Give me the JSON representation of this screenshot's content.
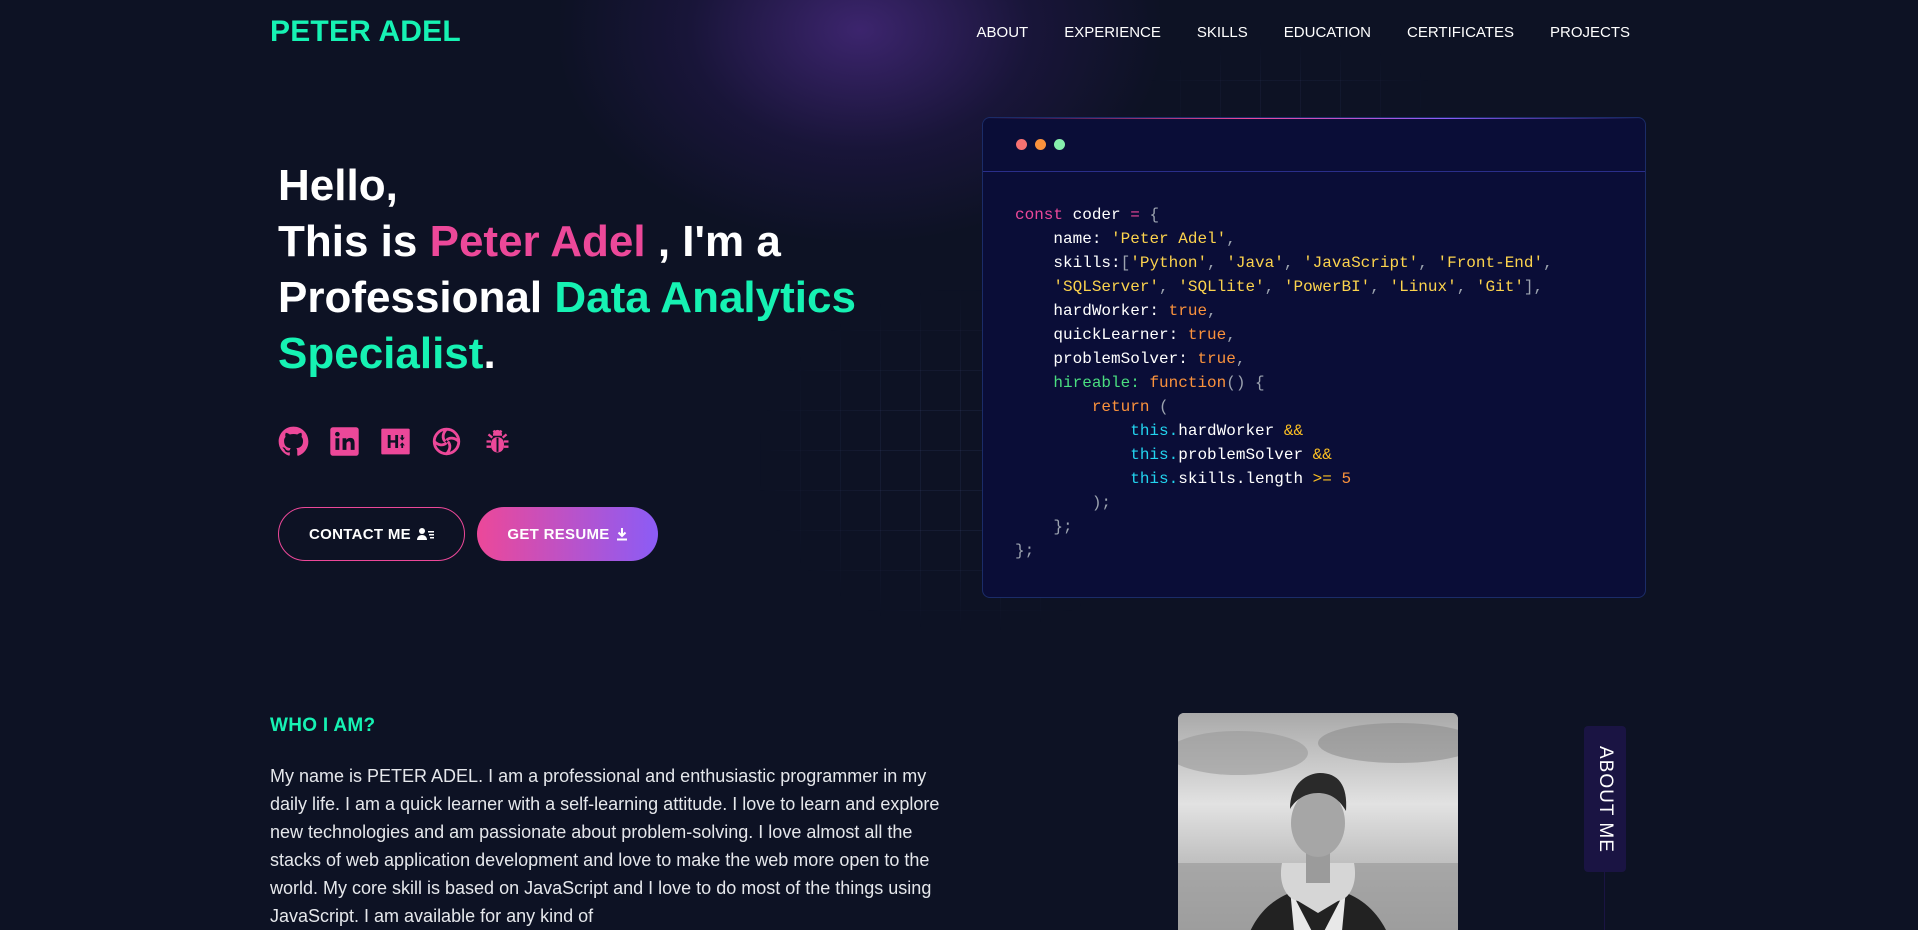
{
  "colors": {
    "bg": "#0d1224",
    "accent_green": "#16f2b3",
    "accent_pink": "#ec4899",
    "accent_purple": "#8b5cf6",
    "code_bg": "#0a0d37"
  },
  "nav": {
    "logo": "PETER ADEL",
    "links": [
      "ABOUT",
      "EXPERIENCE",
      "SKILLS",
      "EDUCATION",
      "CERTIFICATES",
      "PROJECTS"
    ]
  },
  "hero": {
    "greeting": "Hello,",
    "intro_prefix": "This is",
    "name": "Peter Adel",
    "intro_suffix": ", I'm a",
    "role_prefix": "Professional",
    "role": "Data Analytics Specialist",
    "period": ".",
    "socials": [
      {
        "icon": "github-icon"
      },
      {
        "icon": "linkedin-icon"
      },
      {
        "icon": "hackerrank-icon"
      },
      {
        "icon": "openai-icon"
      },
      {
        "icon": "bug-icon"
      }
    ],
    "contact_label": "CONTACT ME",
    "resume_label": "GET RESUME"
  },
  "code": {
    "const_kw": "const",
    "var_name": "coder",
    "name_key": "name:",
    "name_val": "'Peter Adel'",
    "skills_key": "skills:",
    "skills_line1": [
      "'Python'",
      "'Java'",
      "'JavaScript'",
      "'Front-End'"
    ],
    "skills_line2": [
      "'SQLServer'",
      "'SQLlite'",
      "'PowerBI'",
      "'Linux'",
      "'Git'"
    ],
    "hardworker_key": "hardWorker:",
    "quicklearner_key": "quickLearner:",
    "problemsolver_key": "problemSolver:",
    "true_val": "true",
    "hireable_key": "hireable:",
    "function_kw": "function",
    "return_kw": "return",
    "this_kw": "this.",
    "prop1": "hardWorker",
    "prop2": "problemSolver",
    "prop3": "skills.length",
    "and_op": "&&",
    "gte_op": ">=",
    "five": "5"
  },
  "about": {
    "heading": "WHO I AM?",
    "text": "My name is PETER ADEL. I am a professional and enthusiastic programmer in my daily life. I am a quick learner with a self-learning attitude. I love to learn and explore new technologies and am passionate about problem-solving. I love almost all the stacks of web application development and love to make the web more open to the world. My core skill is based on JavaScript and I love to do most of the things using JavaScript. I am available for any kind of",
    "tag": "ABOUT ME"
  }
}
